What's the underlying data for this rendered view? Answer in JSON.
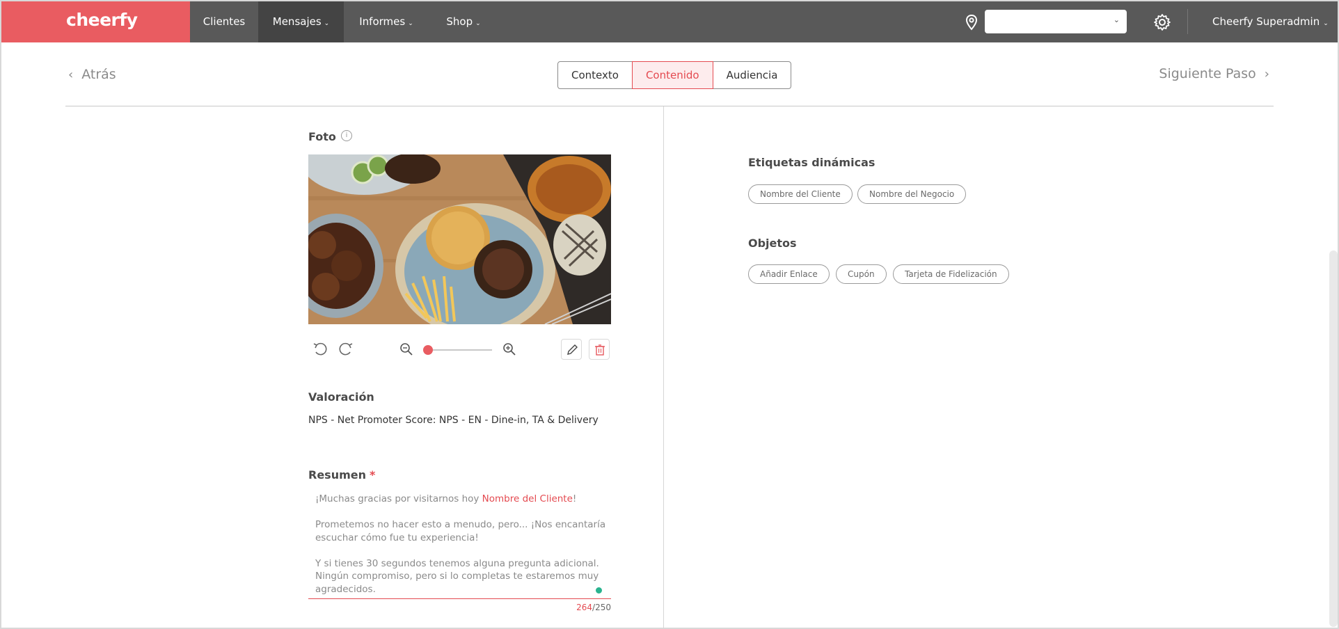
{
  "brand": {
    "name": "cheerfy",
    "color": "#e95c61"
  },
  "nav": {
    "items": [
      {
        "label": "Clientes",
        "has_caret": false,
        "active": false
      },
      {
        "label": "Mensajes",
        "has_caret": true,
        "active": true
      },
      {
        "label": "Informes",
        "has_caret": true,
        "active": false
      },
      {
        "label": "Shop",
        "has_caret": true,
        "active": false
      }
    ],
    "location_select_value": "",
    "user": "Cheerfy Superadmin"
  },
  "stepbar": {
    "back_label": "Atrás",
    "steps": [
      {
        "label": "Contexto",
        "active": false
      },
      {
        "label": "Contenido",
        "active": true
      },
      {
        "label": "Audiencia",
        "active": false
      }
    ],
    "next_label": "Siguiente Paso"
  },
  "photo": {
    "label": "Foto",
    "image_alt": "food-photo",
    "zoom_level": 0
  },
  "rating": {
    "label": "Valoración",
    "value": "NPS - Net Promoter Score: NPS - EN - Dine-in, TA & Delivery"
  },
  "summary": {
    "label": "Resumen",
    "required_mark": "*",
    "line1_prefix": "¡Muchas gracias por visitarnos hoy ",
    "line1_tag": "Nombre del Cliente",
    "line1_suffix": "!",
    "para2": "Prometemos no hacer esto a menudo, pero... ¡Nos encantaría escuchar cómo fue tu experiencia!",
    "para3": "Y si tienes 30 segundos tenemos alguna pregunta adicional. Ningún compromiso, pero si lo completas te estaremos muy agradecidos.",
    "count": "264",
    "max": "/250"
  },
  "dynamic_tags": {
    "title": "Etiquetas dinámicas",
    "items": [
      "Nombre del Cliente",
      "Nombre del Negocio"
    ]
  },
  "objects": {
    "title": "Objetos",
    "items": [
      "Añadir Enlace",
      "Cupón",
      "Tarjeta de Fidelización"
    ]
  },
  "colors": {
    "accent": "#e44a50",
    "nav_bg": "#595959",
    "nav_active": "#444444",
    "status_dot": "#29b38f"
  }
}
